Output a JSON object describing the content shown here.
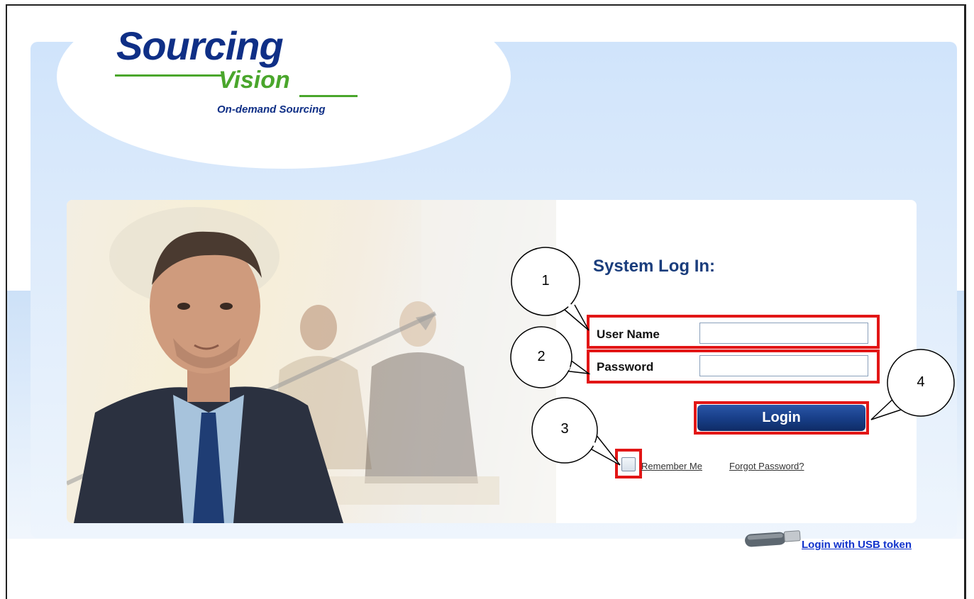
{
  "logo": {
    "word1": "Sourcing",
    "word2": "Vision",
    "tagline": "On-demand Sourcing"
  },
  "login": {
    "title": "System Log In:",
    "username_label": "User Name",
    "username_value": "",
    "password_label": "Password",
    "password_value": "",
    "login_button": "Login",
    "remember_me": "Remember Me",
    "forgot_password": "Forgot Password?",
    "usb_login": "Login with USB token"
  },
  "callouts": [
    "1",
    "2",
    "3",
    "4"
  ],
  "colors": {
    "brand_blue": "#0f2f86",
    "brand_green": "#4aa62c",
    "highlight_red": "#e21616",
    "link_blue": "#1133cc"
  },
  "icons": {
    "usb": "usb-drive-icon"
  }
}
